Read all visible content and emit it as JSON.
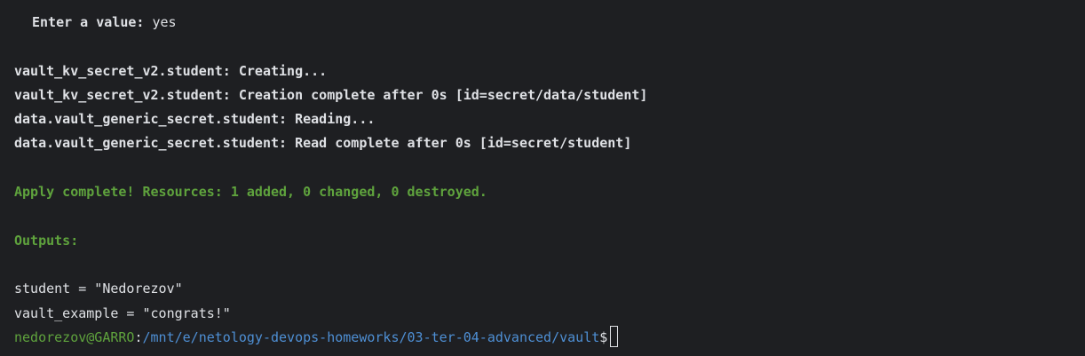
{
  "terminal": {
    "prompt_question": {
      "label": "Enter a value:",
      "answer": " yes"
    },
    "log_lines": [
      "vault_kv_secret_v2.student: Creating...",
      "vault_kv_secret_v2.student: Creation complete after 0s [id=secret/data/student]",
      "data.vault_generic_secret.student: Reading...",
      "data.vault_generic_secret.student: Read complete after 0s [id=secret/student]"
    ],
    "apply_summary": "Apply complete! Resources: 1 added, 0 changed, 0 destroyed.",
    "outputs_header": "Outputs:",
    "outputs": [
      "student = \"Nedorezov\"",
      "vault_example = \"congrats!\""
    ],
    "shell_prompt": {
      "user_host": "nedorezov@GARRO",
      "separator": ":",
      "cwd": "/mnt/e/netology-devops-homeworks/03-ter-04-advanced/vault",
      "symbol": "$"
    },
    "colors": {
      "background": "#1e1f22",
      "text": "#dfe1e5",
      "success_green": "#5fa33d",
      "path_blue": "#4e8fd4"
    }
  }
}
